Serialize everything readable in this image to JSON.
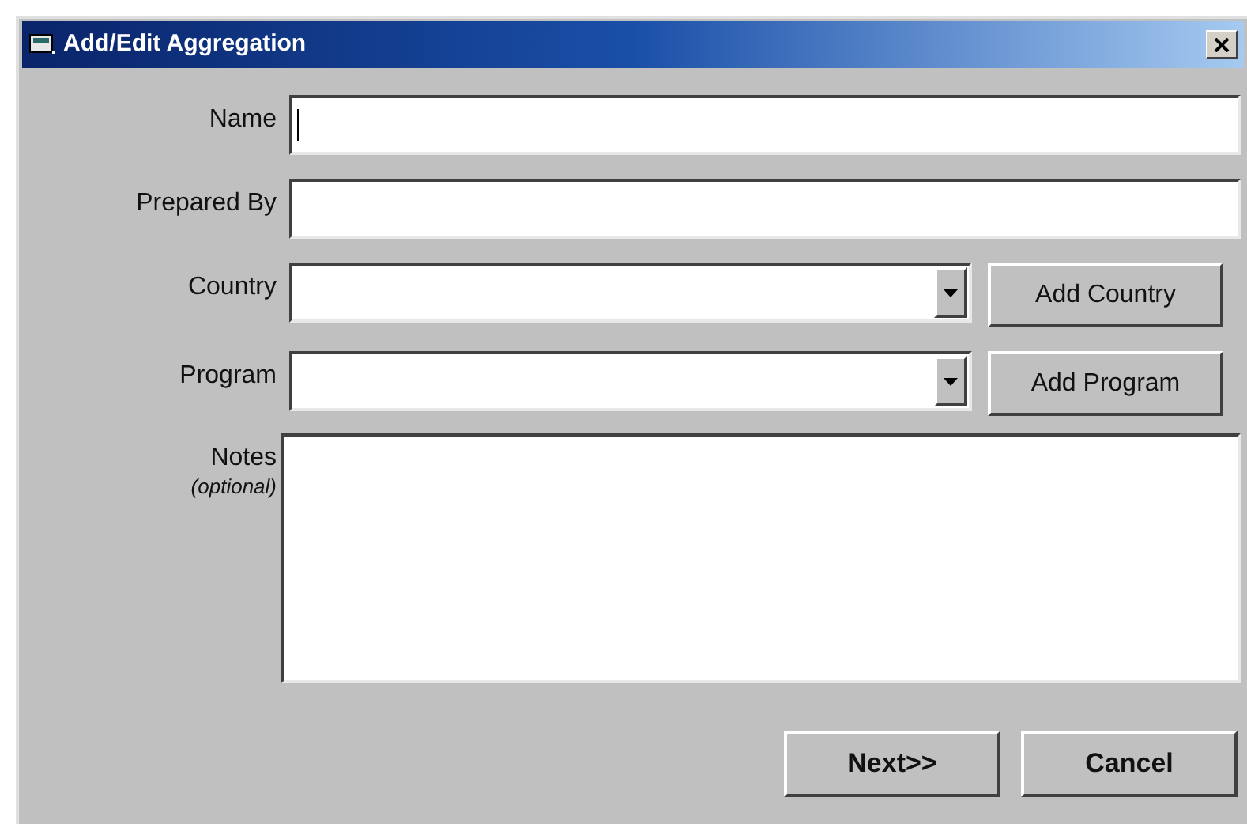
{
  "window": {
    "title": "Add/Edit Aggregation"
  },
  "fields": [
    {
      "kind": "text",
      "label": "Name",
      "focused": true
    },
    {
      "kind": "text",
      "label": "Prepared By",
      "focused": false
    },
    {
      "kind": "combo",
      "label": "Country",
      "focused": false,
      "button": "Add Country"
    },
    {
      "kind": "combo",
      "label": "Program",
      "focused": false,
      "button": "Add Program"
    },
    {
      "kind": "notes",
      "label": "Notes",
      "hint": "(optional)",
      "focused": false
    }
  ],
  "buttons": [
    "Next>>",
    "Cancel"
  ]
}
